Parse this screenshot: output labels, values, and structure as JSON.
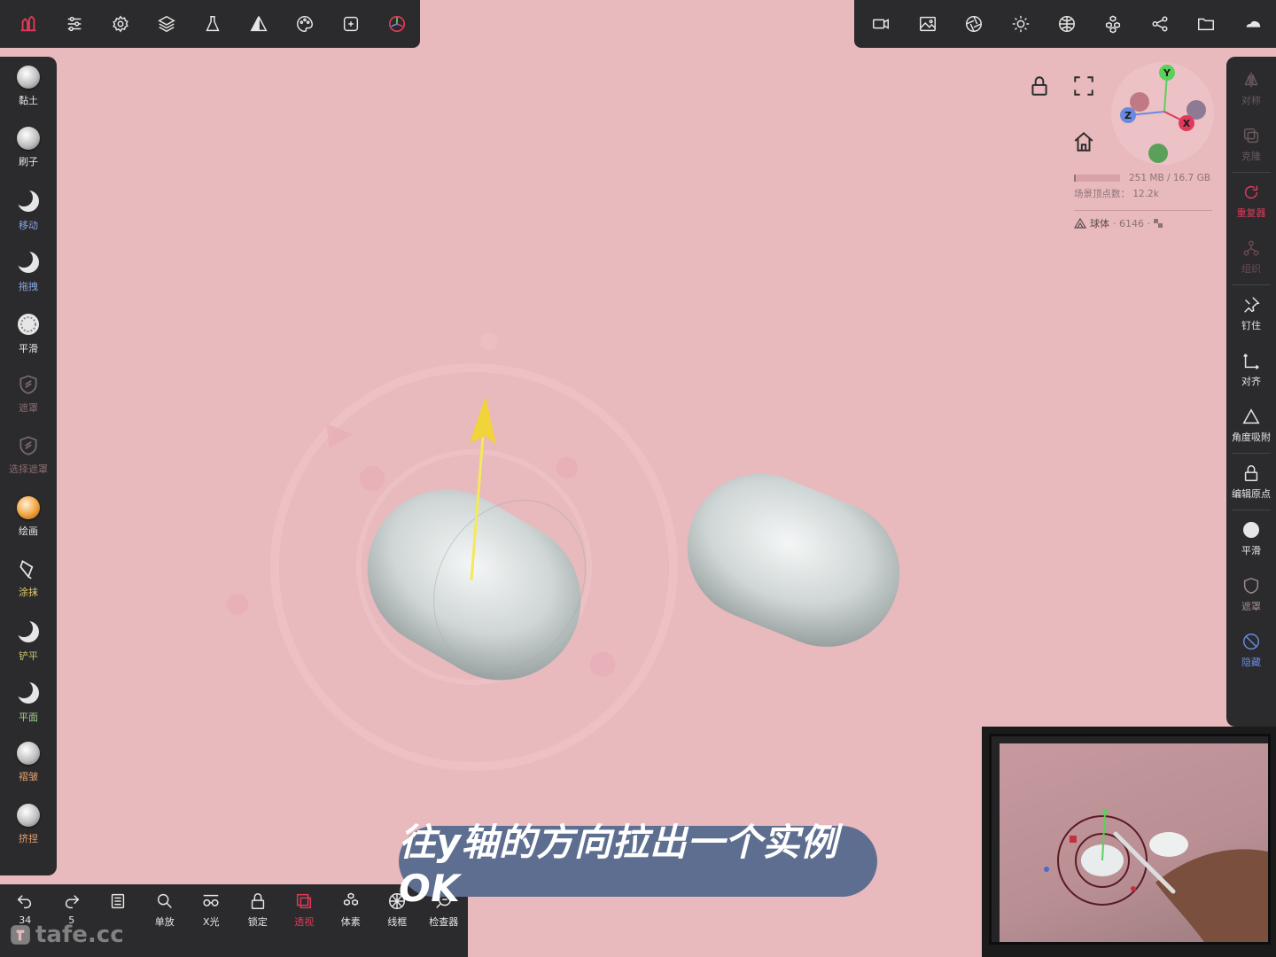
{
  "left_tools": [
    {
      "label": "黏土",
      "color": "#e6e6e6",
      "type": "ball"
    },
    {
      "label": "刷子",
      "color": "#e6e6e6",
      "type": "ball"
    },
    {
      "label": "移动",
      "color": "#8aa6e0",
      "type": "moon"
    },
    {
      "label": "拖拽",
      "color": "#8aa6e0",
      "type": "moon"
    },
    {
      "label": "平滑",
      "color": "#e6e6e6",
      "type": "spiky"
    },
    {
      "label": "遮罩",
      "color": "#8a6a6e",
      "type": "shield-dim"
    },
    {
      "label": "选择遮罩",
      "color": "#8a6a6e",
      "type": "shield-dim"
    },
    {
      "label": "绘画",
      "color": "#e6e6e6",
      "type": "ball-orange"
    },
    {
      "label": "涂抹",
      "color": "#e0c96a",
      "type": "brush"
    },
    {
      "label": "铲平",
      "color": "#c8c36a",
      "type": "moon"
    },
    {
      "label": "平面",
      "color": "#a0d08c",
      "type": "moon"
    },
    {
      "label": "褶皱",
      "color": "#e0a06a",
      "type": "ball"
    },
    {
      "label": "挤捏",
      "color": "#e0a06a",
      "type": "ball"
    }
  ],
  "right_tools": [
    {
      "label": "对称",
      "color": "#6a5a5e",
      "icon": "symmetry-icon",
      "dim": true
    },
    {
      "label": "克隆",
      "color": "#6a5a5e",
      "icon": "clone-icon",
      "dim": true
    },
    {
      "label": "重复器",
      "color": "#e03a5a",
      "icon": "repeat-icon",
      "dim": false
    },
    {
      "label": "组织",
      "color": "#6a4a50",
      "icon": "hierarchy-icon",
      "dim": true
    },
    {
      "label": "钉住",
      "color": "#e6e6e6",
      "icon": "pin-icon",
      "dim": false
    },
    {
      "label": "对齐",
      "color": "#e6e6e6",
      "icon": "align-icon",
      "dim": false
    },
    {
      "label": "角度吸附",
      "color": "#e6e6e6",
      "icon": "angle-snap-icon",
      "dim": false
    },
    {
      "label": "编辑原点",
      "color": "#e6e6e6",
      "icon": "lock-origin-icon",
      "dim": false
    },
    {
      "label": "平滑",
      "color": "#e6e6e6",
      "icon": "smooth-icon",
      "dim": false
    },
    {
      "label": "遮罩",
      "color": "#a08a8e",
      "icon": "mask-icon",
      "dim": true
    },
    {
      "label": "隐藏",
      "color": "#6a8ae0",
      "icon": "hide-icon",
      "dim": false
    }
  ],
  "bottom_tools": [
    {
      "label": "34",
      "color": "#e6e6e6",
      "icon": "undo-icon"
    },
    {
      "label": "5",
      "color": "#e6e6e6",
      "icon": "redo-icon"
    },
    {
      "label": "",
      "color": "#e6e6e6",
      "icon": "history-icon"
    },
    {
      "label": "单放",
      "color": "#e6e6e6",
      "icon": "search-icon"
    },
    {
      "label": "X光",
      "color": "#e6e6e6",
      "icon": "xray-icon"
    },
    {
      "label": "锁定",
      "color": "#e6e6e6",
      "icon": "lock-icon"
    },
    {
      "label": "透视",
      "color": "#e03a5a",
      "icon": "perspective-icon"
    },
    {
      "label": "体素",
      "color": "#e6e6e6",
      "icon": "voxel-icon"
    },
    {
      "label": "线框",
      "color": "#e6e6e6",
      "icon": "wireframe-icon"
    },
    {
      "label": "检查器",
      "color": "#e6e6e6",
      "icon": "inspector-icon"
    }
  ],
  "stats": {
    "memory": "251 MB / 16.7 GB",
    "vertices": "场景顶点数： 12.2k",
    "object_name": "球体",
    "object_count": "· 6146 ·"
  },
  "gizmo_axes": {
    "x": "X",
    "y": "Y",
    "z": "Z"
  },
  "subtitle": "往y轴的方向拉出一个实例OK",
  "watermark": "tafe.cc",
  "colors": {
    "background": "#e8b9bd",
    "panel": "#2b2b2d",
    "accent": "#e03a5a",
    "subtitle_bg": "#5e6e90"
  }
}
